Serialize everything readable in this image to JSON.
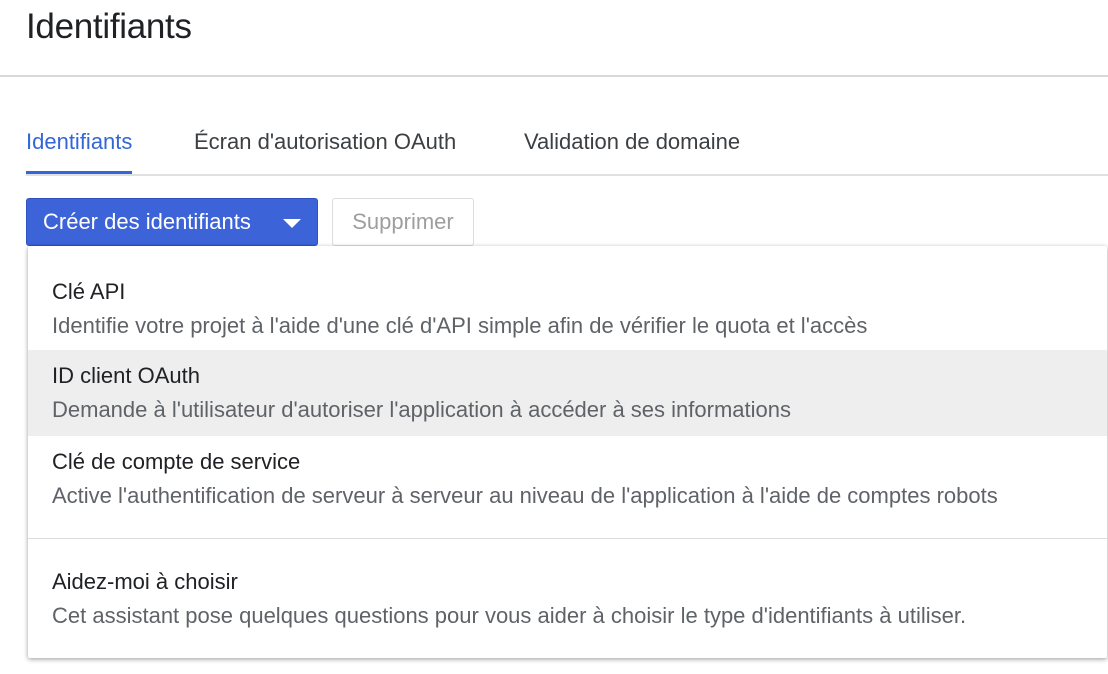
{
  "page": {
    "title": "Identifiants"
  },
  "tabs": [
    {
      "label": "Identifiants",
      "active": true
    },
    {
      "label": "Écran d'autorisation OAuth",
      "active": false
    },
    {
      "label": "Validation de domaine",
      "active": false
    }
  ],
  "toolbar": {
    "create_label": "Créer des identifiants",
    "create_icon": "caret-down-icon",
    "delete_label": "Supprimer",
    "delete_disabled": true
  },
  "menu": {
    "items": [
      {
        "title": "Clé API",
        "description": "Identifie votre projet à l'aide d'une clé d'API simple afin de vérifier le quota et l'accès",
        "highlighted": false
      },
      {
        "title": "ID client OAuth",
        "description": "Demande à l'utilisateur d'autoriser l'application à accéder à ses informations",
        "highlighted": true
      },
      {
        "title": "Clé de compte de service",
        "description": "Active l'authentification de serveur à serveur au niveau de l'application à l'aide de comptes robots",
        "highlighted": false
      },
      {
        "title": "Aidez-moi à choisir",
        "description": "Cet assistant pose quelques questions pour vous aider à choisir le type d'identifiants à utiliser.",
        "highlighted": false
      }
    ]
  },
  "colors": {
    "accent": "#3367d6",
    "primary_button": "#3c63d8",
    "highlight_row": "#eeeeee"
  }
}
